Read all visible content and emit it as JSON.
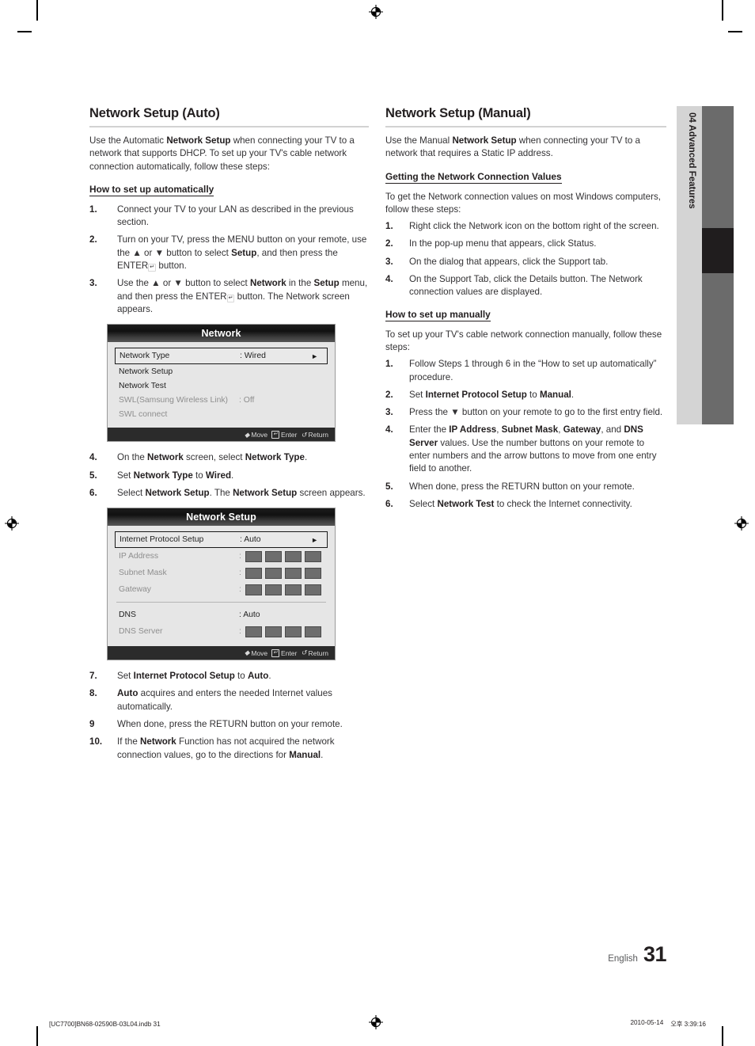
{
  "page": {
    "language": "English",
    "number": "31",
    "side_tab_chapter": "04",
    "side_tab_title": "Advanced Features",
    "side_tab_full": "04  Advanced Features"
  },
  "print_footer": {
    "file": "[UC7700]BN68-02590B-03L04.indb   31",
    "date": "2010-05-14",
    "time": "오후 3:39:16"
  },
  "left_column": {
    "title": "Network Setup (Auto)",
    "intro": "Use the Automatic Network Setup when connecting your TV to a network that supports DHCP. To set up your TV's cable network connection automatically, follow these steps:",
    "subheading": "How to set up automatically",
    "steps_1_3": [
      {
        "num": "1.",
        "text": "Connect your TV to your LAN as described in the previous section."
      },
      {
        "num": "2.",
        "text": "Turn on your TV, press the MENU button on your remote, use the ▲ or ▼ button to select Setup, and then press the ENTER ↵ button."
      },
      {
        "num": "3.",
        "text": "Use the ▲ or ▼ button to select Network in the Setup menu, and then press the ENTER ↵ button. The Network screen appears."
      }
    ],
    "steps_4_6": [
      {
        "num": "4.",
        "text": "On the Network screen, select Network Type."
      },
      {
        "num": "5.",
        "text": "Set Network Type to Wired."
      },
      {
        "num": "6.",
        "text": "Select Network Setup. The Network Setup screen appears."
      }
    ],
    "steps_7_10": [
      {
        "num": "7.",
        "text": "Set Internet Protocol Setup to Auto."
      },
      {
        "num": "8.",
        "text": "Auto acquires and enters the needed Internet values automatically."
      },
      {
        "num": "9",
        "text": "When done, press the RETURN button on your remote."
      },
      {
        "num": "10.",
        "text": "If the Network Function has not acquired the network connection values, go to the directions for Manual."
      }
    ]
  },
  "right_column": {
    "title": "Network Setup (Manual)",
    "intro": "Use the Manual Network Setup when connecting your TV to a network that requires a Static IP address.",
    "subheading_values": "Getting the Network Connection Values",
    "values_intro": "To get the Network connection values on most Windows computers, follow these steps:",
    "values_steps": [
      {
        "num": "1.",
        "text": "Right click the Network icon on the bottom right of the screen."
      },
      {
        "num": "2.",
        "text": "In the pop-up menu that appears, click Status."
      },
      {
        "num": "3.",
        "text": "On the dialog that appears, click the Support tab."
      },
      {
        "num": "4.",
        "text": "On the Support Tab, click the Details button. The Network connection values are displayed."
      }
    ],
    "subheading_manual": "How to set up manually",
    "manual_intro": "To set up your TV's cable network connection manually, follow these steps:",
    "manual_steps": [
      {
        "num": "1.",
        "text": "Follow Steps 1 through 6 in the “How to set up automatically” procedure."
      },
      {
        "num": "2.",
        "text": "Set Internet Protocol Setup to Manual."
      },
      {
        "num": "3.",
        "text": "Press the ▼ button on your remote to go to the first entry field."
      },
      {
        "num": "4.",
        "text": "Enter the IP Address, Subnet Mask, Gateway, and DNS Server values. Use the number buttons on your remote to enter numbers and the arrow buttons to move from one entry field to another."
      },
      {
        "num": "5.",
        "text": "When done, press the RETURN button on your remote."
      },
      {
        "num": "6.",
        "text": "Select Network Test to check the Internet connectivity."
      }
    ]
  },
  "osd_network": {
    "title": "Network",
    "rows": [
      {
        "label": "Network Type",
        "value": ": Wired",
        "selected": true,
        "dim": false,
        "arrow": "►"
      },
      {
        "label": "Network Setup",
        "value": "",
        "selected": false,
        "dim": false
      },
      {
        "label": "Network Test",
        "value": "",
        "selected": false,
        "dim": false
      },
      {
        "label": "SWL(Samsung Wireless Link)",
        "value": ": Off",
        "selected": false,
        "dim": true
      },
      {
        "label": "SWL connect",
        "value": "",
        "selected": false,
        "dim": true
      }
    ],
    "footer": {
      "move": "Move",
      "enter": "Enter",
      "return": "Return"
    }
  },
  "osd_network_setup": {
    "title": "Network Setup",
    "rows": [
      {
        "label": "Internet Protocol Setup",
        "value": ": Auto",
        "type": "value",
        "selected": true,
        "dim": false,
        "arrow": "►"
      },
      {
        "label": "IP Address",
        "value": ":",
        "type": "boxes",
        "selected": false,
        "dim": true
      },
      {
        "label": "Subnet Mask",
        "value": ":",
        "type": "boxes",
        "selected": false,
        "dim": true
      },
      {
        "label": "Gateway",
        "value": ":",
        "type": "boxes",
        "selected": false,
        "dim": true
      },
      {
        "label": "DNS",
        "value": ": Auto",
        "type": "value",
        "selected": false,
        "dim": false
      },
      {
        "label": "DNS Server",
        "value": ":",
        "type": "boxes",
        "selected": false,
        "dim": true
      }
    ],
    "footer": {
      "move": "Move",
      "enter": "Enter",
      "return": "Return"
    }
  },
  "colors": {
    "osd_body": "#e6e6e6",
    "osd_footer": "#2b2b2b",
    "side_tab_band": "#d4d4d4",
    "side_tab_bar": "#6b6b6b",
    "side_tab_active": "#201d1e",
    "rule": "#d2d2d2",
    "text": "#231f20"
  }
}
